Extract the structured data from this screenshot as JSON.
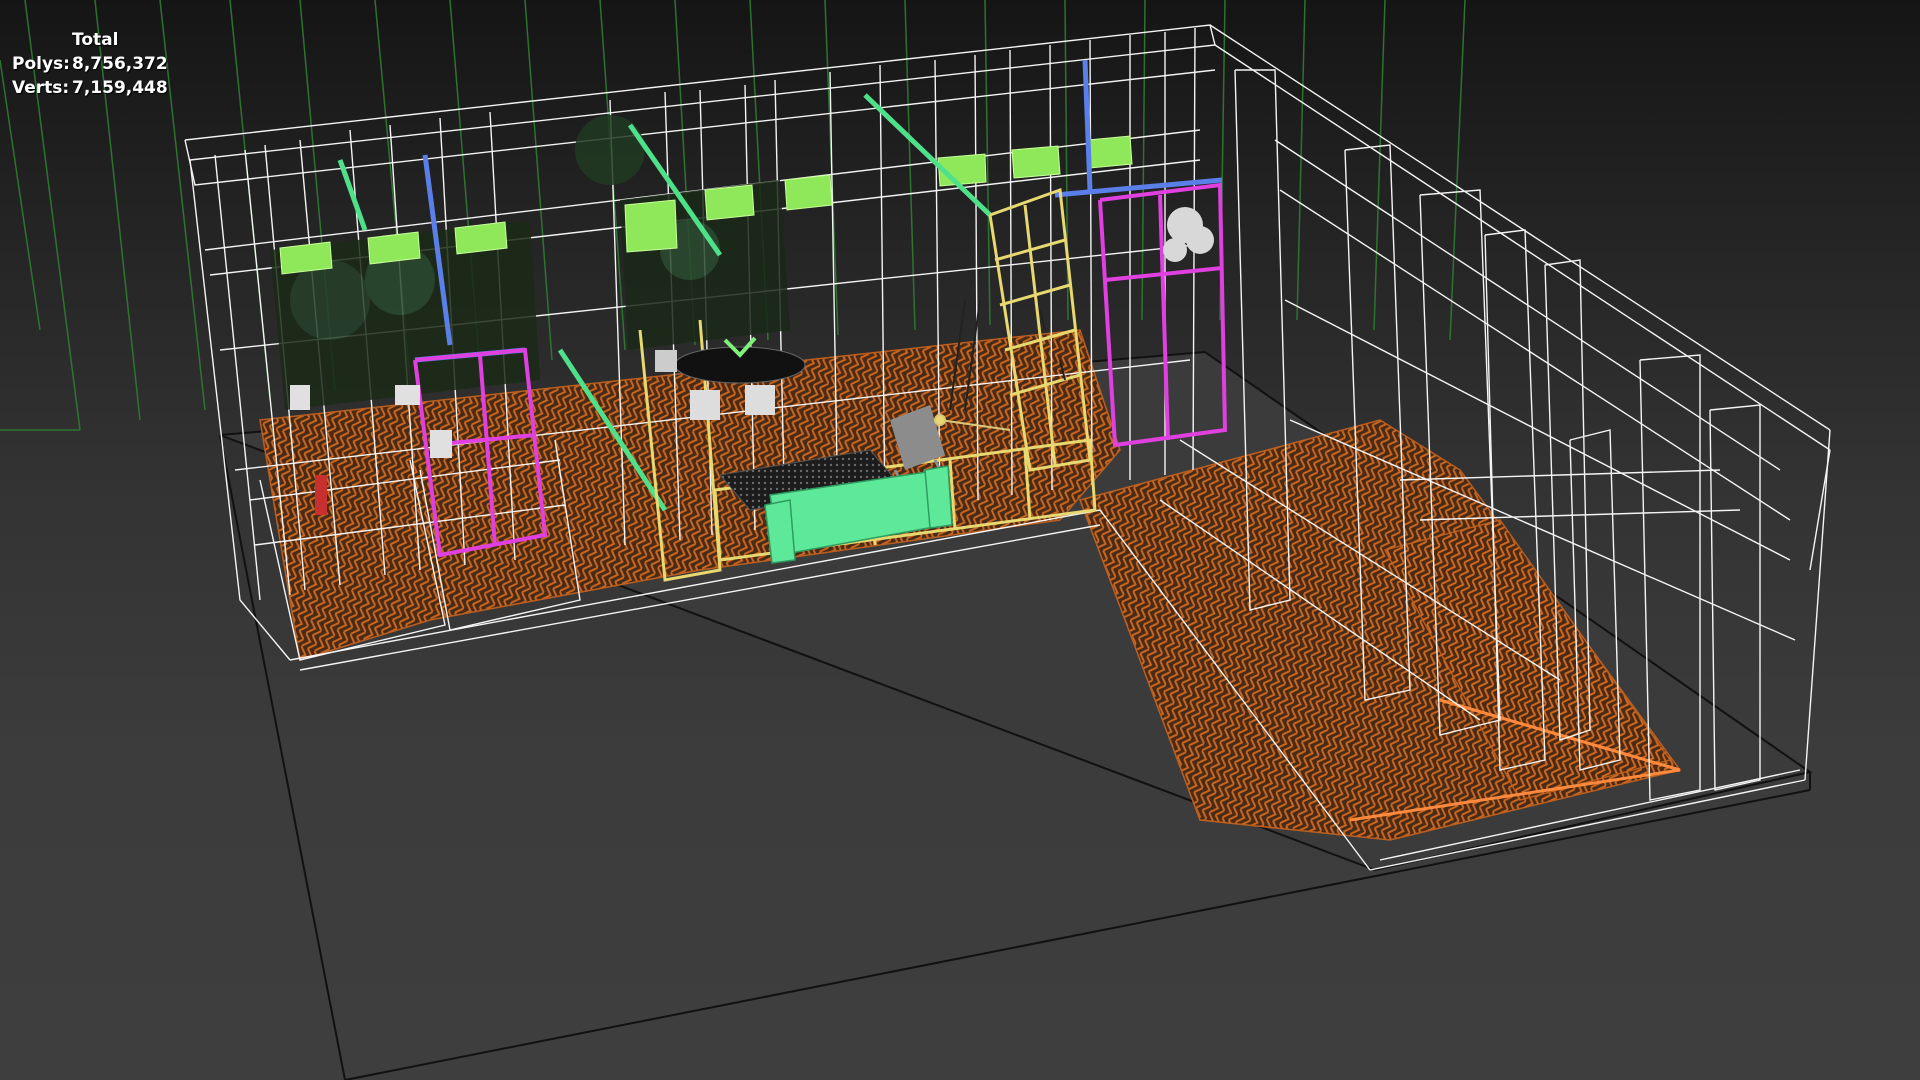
{
  "stats": {
    "title": "Total",
    "polys_label": "Polys:",
    "polys_value": "8,756,372",
    "verts_label": "Verts:",
    "verts_value": "7,159,448"
  },
  "colors": {
    "background": "#333333",
    "wireframe": "#ffffff",
    "grid": "#2e7d32",
    "floor": "#c2611f",
    "sofa": "#5ee89a",
    "glass_panes": "#8fe85a",
    "magenta_frames": "#e040e0",
    "yellow_frames": "#e8d870",
    "blue_beams": "#5b7fe8",
    "rug": "#222222"
  },
  "icons": [
    "wireframe-room-model",
    "viewport-grid"
  ]
}
